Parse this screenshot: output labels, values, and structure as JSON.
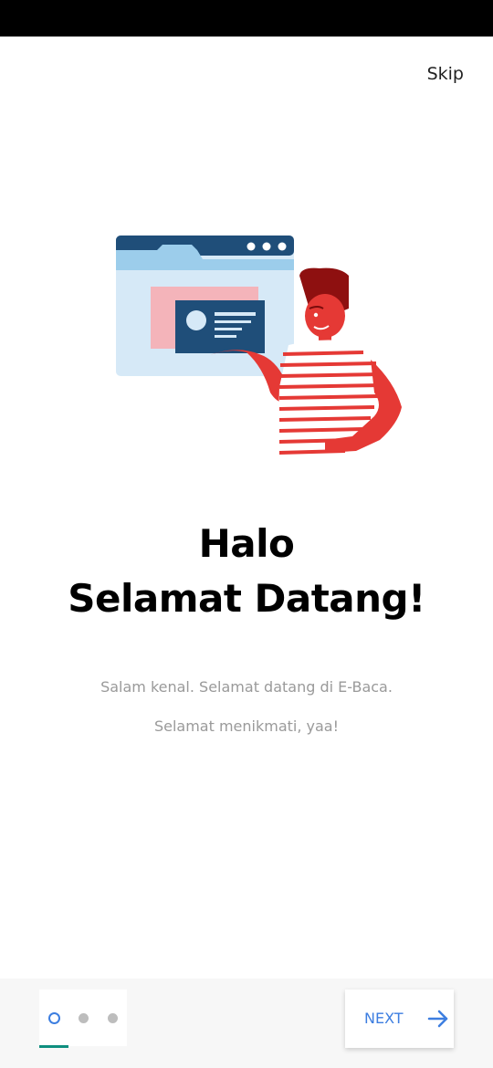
{
  "header": {
    "skip_label": "Skip"
  },
  "content": {
    "title_line1": "Halo",
    "title_line2": "Selamat Datang!",
    "subtitle_line1": "Salam kenal. Selamat datang di E-Baca.",
    "subtitle_line2": "Selamat menikmati, yaa!"
  },
  "pager": {
    "total_pages": 3,
    "current_page": 1
  },
  "footer": {
    "next_label": "NEXT"
  },
  "colors": {
    "accent": "#3d7ee0",
    "indicator": "#0f8f7f",
    "illustration_red": "#e53935",
    "illustration_navy": "#1f4e79",
    "illustration_light_blue": "#d6e9f7"
  },
  "icons": {
    "next": "arrow-right-icon"
  }
}
